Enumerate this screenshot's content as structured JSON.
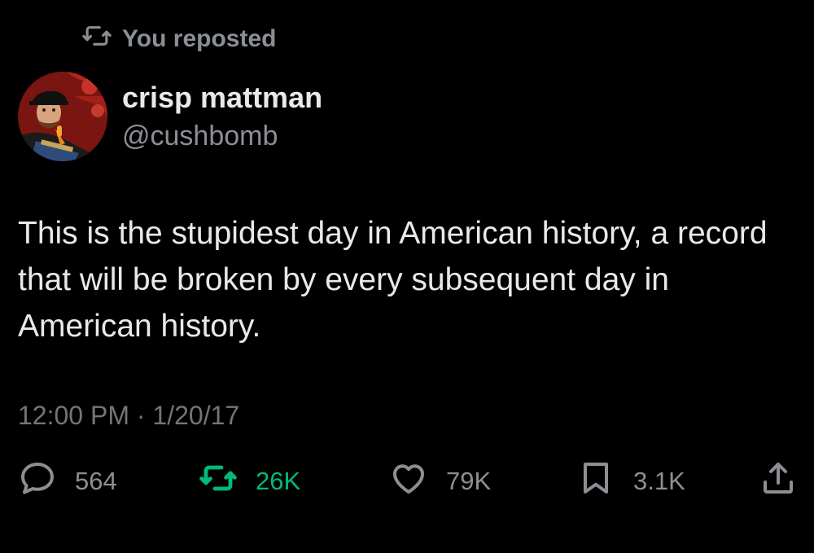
{
  "repost_banner": {
    "label": "You reposted",
    "icon": "repost-icon"
  },
  "author": {
    "display_name": "crisp mattman",
    "handle": "@cushbomb",
    "avatar": "avatar-portrait"
  },
  "tweet": {
    "text": "This is the stupidest day in American history, a record that will be broken by every subsequent day in American history.",
    "timestamp": "12:00 PM · 1/20/17"
  },
  "actions": {
    "replies": {
      "count": "564",
      "icon": "reply-icon"
    },
    "reposts": {
      "count": "26K",
      "icon": "repost-icon",
      "active": true,
      "color": "#00ba7c"
    },
    "likes": {
      "count": "79K",
      "icon": "heart-icon"
    },
    "bookmarks": {
      "count": "3.1K",
      "icon": "bookmark-icon"
    },
    "share": {
      "icon": "share-icon"
    }
  },
  "colors": {
    "background": "#000000",
    "primary_text": "#e7e9ea",
    "secondary_text": "#8b8f94",
    "repost_active": "#00ba7c"
  }
}
